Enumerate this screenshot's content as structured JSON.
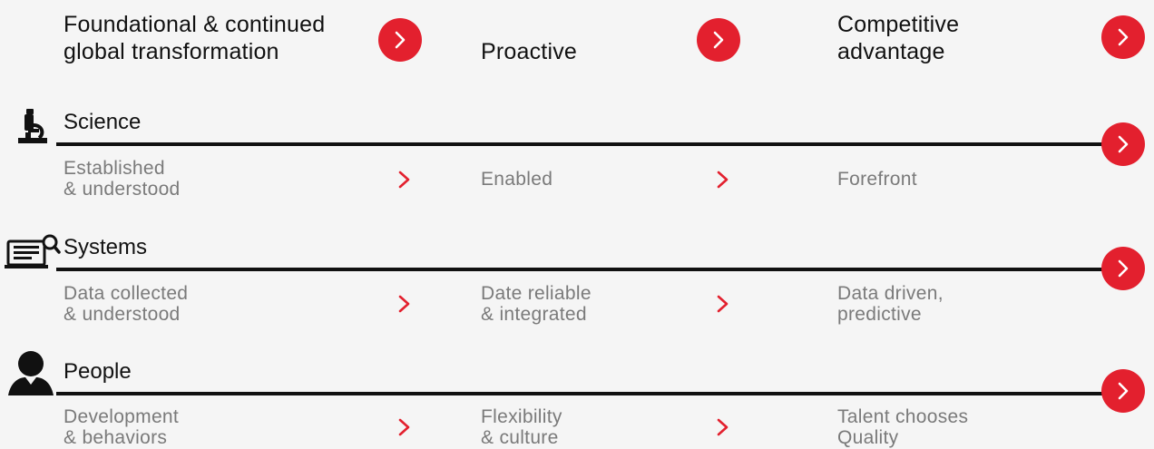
{
  "colors": {
    "accent": "#e3202e",
    "text": "#111111",
    "muted": "#7a7a7a",
    "background": "#f5f5f5"
  },
  "stages": [
    {
      "line1": "Foundational & continued",
      "line2": "global transformation"
    },
    {
      "line1": "",
      "line2": "Proactive"
    },
    {
      "line1": "Competitive",
      "line2": "advantage"
    }
  ],
  "categories": [
    {
      "label": "Science",
      "icon": "microscope-icon",
      "items": [
        {
          "line1": "Established",
          "line2": "& understood"
        },
        {
          "line1": "",
          "line2": "Enabled"
        },
        {
          "line1": "",
          "line2": "Forefront"
        }
      ]
    },
    {
      "label": "Systems",
      "icon": "computer-search-icon",
      "items": [
        {
          "line1": "Data collected",
          "line2": "& understood"
        },
        {
          "line1": "Date reliable",
          "line2": "& integrated"
        },
        {
          "line1": "Data driven,",
          "line2": "predictive"
        }
      ]
    },
    {
      "label": "People",
      "icon": "person-icon",
      "items": [
        {
          "line1": "Development",
          "line2": "& behaviors"
        },
        {
          "line1": "Flexibility",
          "line2": "& culture"
        },
        {
          "line1": "Talent chooses",
          "line2": "Quality"
        }
      ]
    }
  ]
}
